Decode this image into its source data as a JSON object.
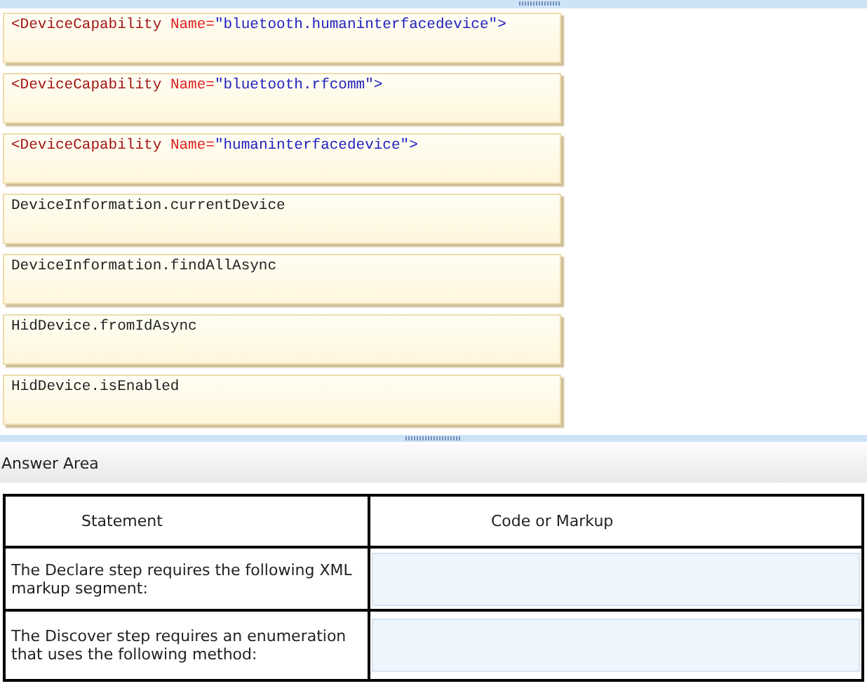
{
  "options": [
    {
      "kind": "markup",
      "parts": [
        {
          "kind": "tag",
          "text": "<DeviceCapability"
        },
        {
          "kind": "attr",
          "text": "Name="
        },
        {
          "kind": "value",
          "text": "\"bluetooth.humaninterfacedevice\">"
        }
      ]
    },
    {
      "kind": "markup",
      "parts": [
        {
          "kind": "tag",
          "text": "<DeviceCapability"
        },
        {
          "kind": "attr",
          "text": "Name="
        },
        {
          "kind": "value",
          "text": "\"bluetooth.rfcomm\">"
        }
      ]
    },
    {
      "kind": "markup",
      "parts": [
        {
          "kind": "tag",
          "text": "<DeviceCapability"
        },
        {
          "kind": "attr",
          "text": "Name="
        },
        {
          "kind": "value",
          "text": "\"humaninterfacedevice\">"
        }
      ]
    },
    {
      "kind": "code",
      "text": "DeviceInformation.currentDevice"
    },
    {
      "kind": "code",
      "text": "DeviceInformation.findAllAsync"
    },
    {
      "kind": "code",
      "text": "HidDevice.fromIdAsync"
    },
    {
      "kind": "code",
      "text": "HidDevice.isEnabled"
    }
  ],
  "answer_area": {
    "title": "Answer Area",
    "columns": [
      "Statement",
      "Code or Markup"
    ],
    "rows": [
      {
        "statement": "The Declare step requires the following XML markup segment:"
      },
      {
        "statement": "The Discover step requires an enumeration that uses the following method:"
      }
    ]
  }
}
